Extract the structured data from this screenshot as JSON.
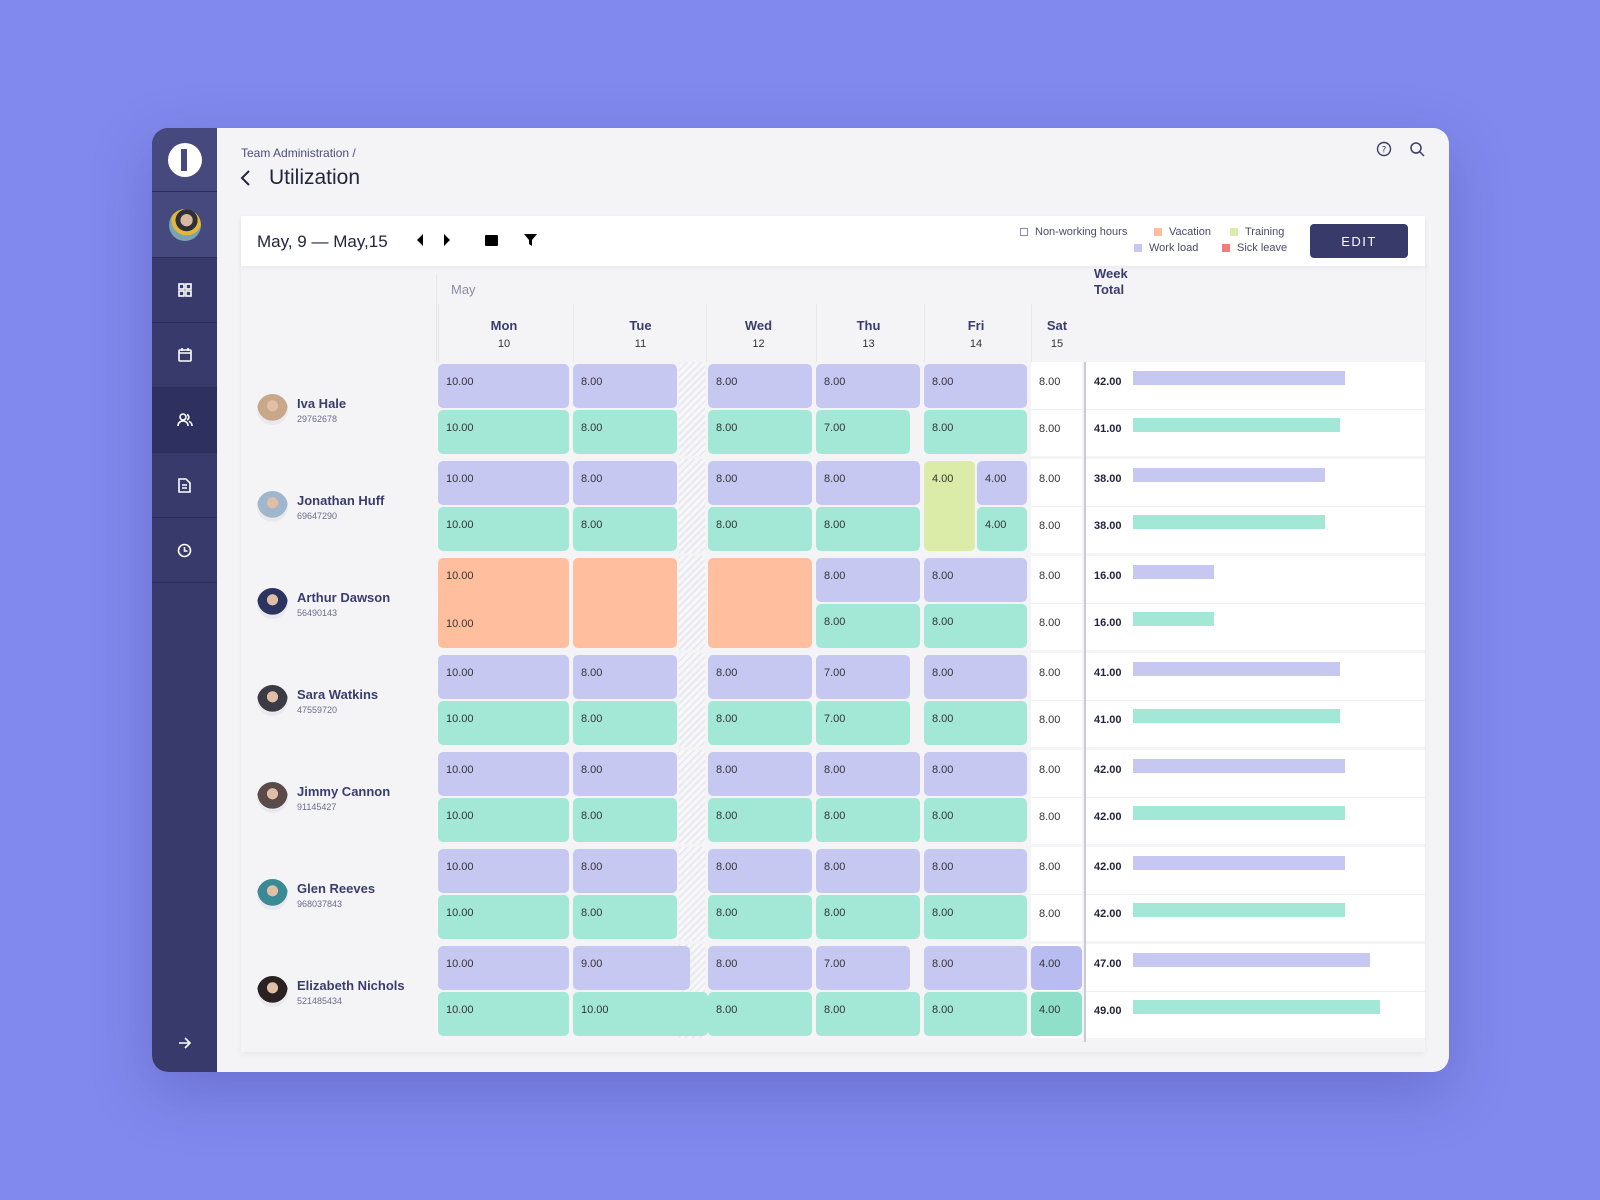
{
  "breadcrumb": "Team Administration /",
  "title": "Utilization",
  "toolbar": {
    "range": "May, 9 — May,15",
    "edit_label": "EDIT"
  },
  "legend": [
    {
      "label": "Non-working hours",
      "color": "#ffffff"
    },
    {
      "label": "Vacation",
      "color": "#ffbf9f"
    },
    {
      "label": "Training",
      "color": "#dbeba8"
    },
    {
      "label": "Work load",
      "color": "#c7c8f2"
    },
    {
      "label": "Sick leave",
      "color": "#f37b7b"
    }
  ],
  "colors": {
    "work": "#c7c8f2",
    "actual": "#a3e8d6",
    "vacation": "#ffbf9f",
    "training": "#dbeba8",
    "work_sat": "#b9bcf0",
    "actual_sat": "#8fdfc9"
  },
  "month": "May",
  "days": [
    {
      "name": "Mon",
      "num": "10"
    },
    {
      "name": "Tue",
      "num": "11"
    },
    {
      "name": "Wed",
      "num": "12"
    },
    {
      "name": "Thu",
      "num": "13"
    },
    {
      "name": "Fri",
      "num": "14"
    },
    {
      "name": "Sat",
      "num": "15"
    }
  ],
  "week_total_label": "Week Total",
  "bar_max": 49,
  "people": [
    {
      "name": "Iva Hale",
      "id": "29762678",
      "avatar": "#c9a88a",
      "cells": [
        {
          "k": "pair",
          "top": "10.00",
          "bottom": "10.00"
        },
        {
          "k": "pair",
          "top": "8.00",
          "bottom": "8.00"
        },
        {
          "k": "pair",
          "top": "8.00",
          "bottom": "8.00"
        },
        {
          "k": "pair",
          "top": "8.00",
          "bottom": "7.00"
        },
        {
          "k": "pair",
          "top": "8.00",
          "bottom": "8.00"
        },
        {
          "k": "plain",
          "top": "8.00",
          "bottom": "8.00"
        }
      ],
      "totals": [
        "42.00",
        "41.00"
      ],
      "bars": [
        42,
        41
      ]
    },
    {
      "name": "Jonathan Huff",
      "id": "69647290",
      "avatar": "#9fb6cc",
      "cells": [
        {
          "k": "pair",
          "top": "10.00",
          "bottom": "10.00"
        },
        {
          "k": "pair",
          "top": "8.00",
          "bottom": "8.00"
        },
        {
          "k": "pair",
          "top": "8.00",
          "bottom": "8.00"
        },
        {
          "k": "pair",
          "top": "8.00",
          "bottom": "8.00"
        },
        {
          "k": "split",
          "left": "4.00",
          "top": "4.00",
          "bottom": "4.00"
        },
        {
          "k": "plain",
          "top": "8.00",
          "bottom": "8.00"
        }
      ],
      "totals": [
        "38.00",
        "38.00"
      ],
      "bars": [
        38,
        38
      ]
    },
    {
      "name": "Arthur Dawson",
      "id": "56490143",
      "avatar": "#2b3560",
      "cells": [
        {
          "k": "span",
          "top": "10.00",
          "bottom": "10.00"
        },
        {
          "k": "span",
          "top": "",
          "bottom": ""
        },
        {
          "k": "span",
          "top": "",
          "bottom": ""
        },
        {
          "k": "pair",
          "top": "8.00",
          "bottom": "8.00"
        },
        {
          "k": "pair",
          "top": "8.00",
          "bottom": "8.00"
        },
        {
          "k": "plain",
          "top": "8.00",
          "bottom": "8.00"
        }
      ],
      "totals": [
        "16.00",
        "16.00"
      ],
      "bars": [
        16,
        16
      ]
    },
    {
      "name": "Sara Watkins",
      "id": "47559720",
      "avatar": "#3b3b45",
      "cells": [
        {
          "k": "pair",
          "top": "10.00",
          "bottom": "10.00"
        },
        {
          "k": "pair",
          "top": "8.00",
          "bottom": "8.00"
        },
        {
          "k": "pair",
          "top": "8.00",
          "bottom": "8.00"
        },
        {
          "k": "pair",
          "top": "7.00",
          "bottom": "7.00"
        },
        {
          "k": "pair",
          "top": "8.00",
          "bottom": "8.00"
        },
        {
          "k": "plain",
          "top": "8.00",
          "bottom": "8.00"
        }
      ],
      "totals": [
        "41.00",
        "41.00"
      ],
      "bars": [
        41,
        41
      ]
    },
    {
      "name": "Jimmy Cannon",
      "id": "91145427",
      "avatar": "#5a4a48",
      "cells": [
        {
          "k": "pair",
          "top": "10.00",
          "bottom": "10.00"
        },
        {
          "k": "pair",
          "top": "8.00",
          "bottom": "8.00"
        },
        {
          "k": "pair",
          "top": "8.00",
          "bottom": "8.00"
        },
        {
          "k": "pair",
          "top": "8.00",
          "bottom": "8.00"
        },
        {
          "k": "pair",
          "top": "8.00",
          "bottom": "8.00"
        },
        {
          "k": "plain",
          "top": "8.00",
          "bottom": "8.00"
        }
      ],
      "totals": [
        "42.00",
        "42.00"
      ],
      "bars": [
        42,
        42
      ]
    },
    {
      "name": "Glen Reeves",
      "id": "968037843",
      "avatar": "#3a8a96",
      "cells": [
        {
          "k": "pair",
          "top": "10.00",
          "bottom": "10.00"
        },
        {
          "k": "pair",
          "top": "8.00",
          "bottom": "8.00"
        },
        {
          "k": "pair",
          "top": "8.00",
          "bottom": "8.00"
        },
        {
          "k": "pair",
          "top": "8.00",
          "bottom": "8.00"
        },
        {
          "k": "pair",
          "top": "8.00",
          "bottom": "8.00"
        },
        {
          "k": "plain",
          "top": "8.00",
          "bottom": "8.00"
        }
      ],
      "totals": [
        "42.00",
        "42.00"
      ],
      "bars": [
        42,
        42
      ]
    },
    {
      "name": "Elizabeth Nichols",
      "id": "521485434",
      "avatar": "#2a2222",
      "cells": [
        {
          "k": "pair",
          "top": "10.00",
          "bottom": "10.00"
        },
        {
          "k": "pair",
          "top": "9.00",
          "bottom": "10.00"
        },
        {
          "k": "pair",
          "top": "8.00",
          "bottom": "8.00"
        },
        {
          "k": "pair",
          "top": "7.00",
          "bottom": "8.00"
        },
        {
          "k": "pair",
          "top": "8.00",
          "bottom": "8.00"
        },
        {
          "k": "pair",
          "top": "4.00",
          "bottom": "4.00"
        }
      ],
      "totals": [
        "47.00",
        "49.00"
      ],
      "bars": [
        47,
        49
      ]
    }
  ]
}
